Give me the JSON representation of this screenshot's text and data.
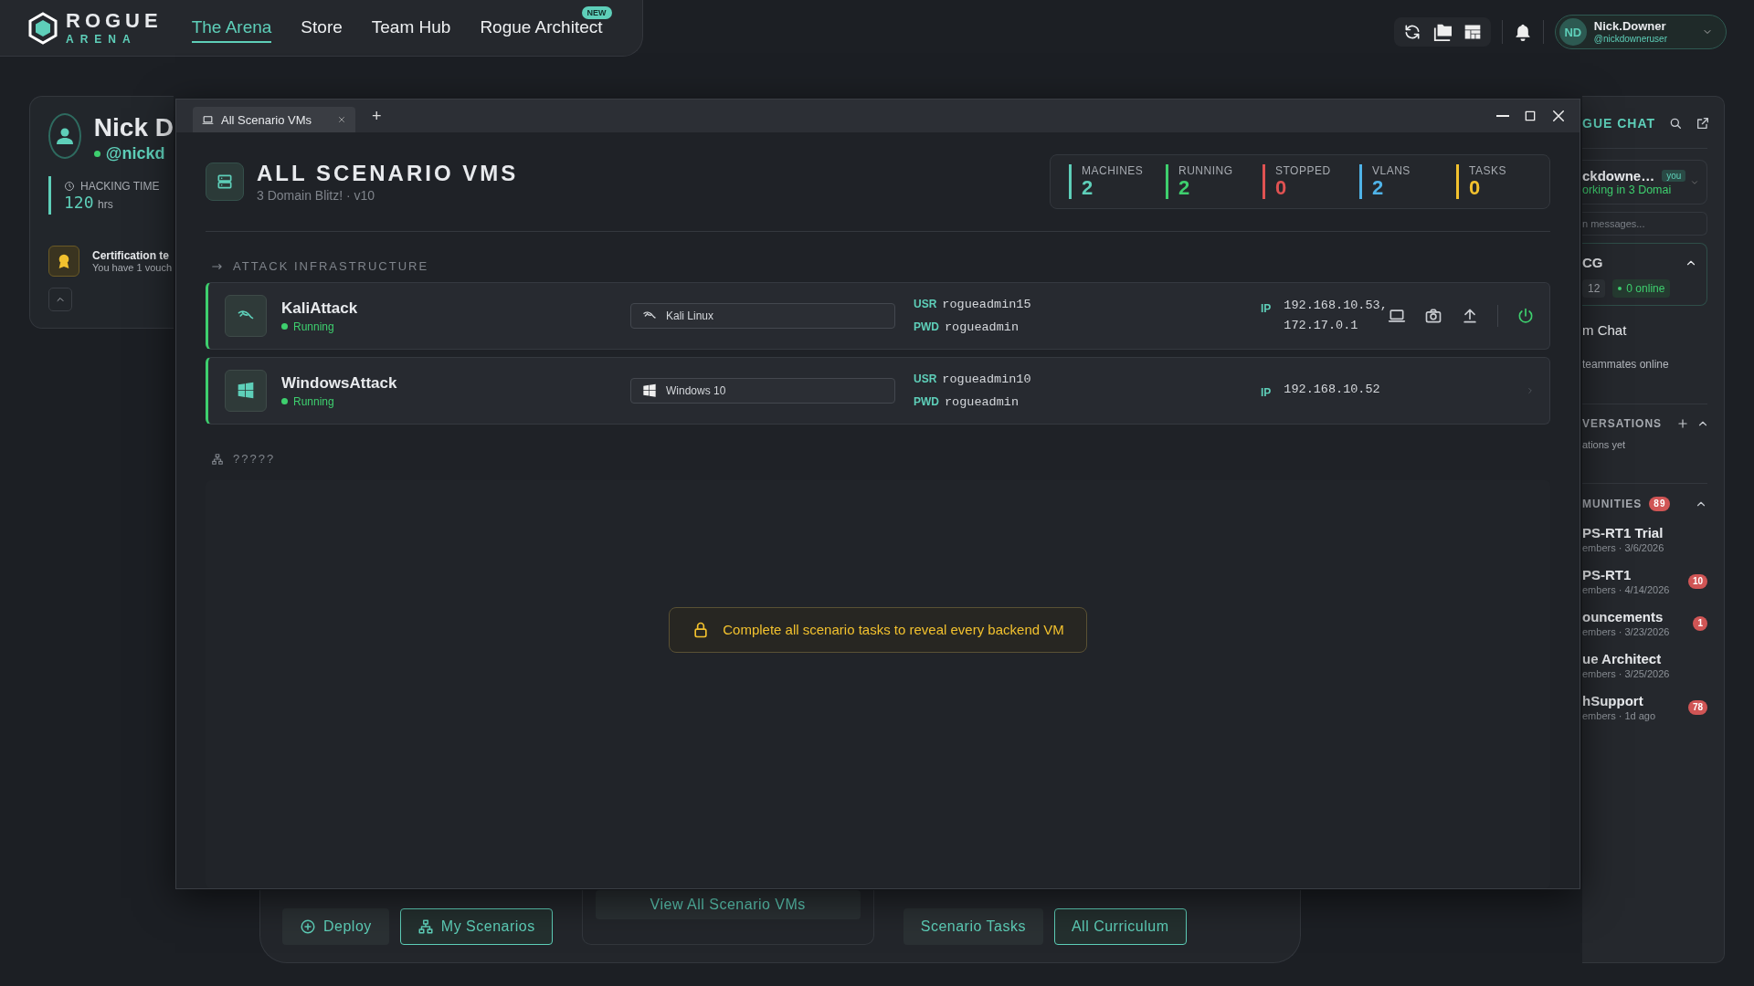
{
  "nav": {
    "logo_top": "ROGUE",
    "logo_bottom": "ARENA",
    "links": [
      {
        "label": "The Arena",
        "selected": true
      },
      {
        "label": "Store",
        "selected": false
      },
      {
        "label": "Team Hub",
        "selected": false
      },
      {
        "label": "Rogue Architect",
        "selected": false,
        "badge": "NEW"
      }
    ],
    "user": {
      "initials": "ND",
      "name": "Nick.Downer",
      "handle": "@nickdowneruser"
    }
  },
  "profile": {
    "name": "Nick D",
    "handle": "@nickd",
    "online": true,
    "stat_label": "HACKING TIME",
    "stat_value": "120",
    "stat_unit": "hrs",
    "cert_title": "Certification te",
    "cert_text": "You have 1 vouch"
  },
  "window": {
    "tab": "All Scenario VMs",
    "add_tab": "+",
    "title": "ALL SCENARIO VMS",
    "subtitle": "3 Domain Blitz! · v10",
    "stats": [
      {
        "label": "MACHINES",
        "value": "2",
        "color": "#5ecfb9"
      },
      {
        "label": "RUNNING",
        "value": "2",
        "color": "#3ecf6e"
      },
      {
        "label": "STOPPED",
        "value": "0",
        "color": "#e05252"
      },
      {
        "label": "VLANS",
        "value": "2",
        "color": "#4fb3e8"
      },
      {
        "label": "TASKS",
        "value": "0",
        "color": "#f2c12e"
      }
    ],
    "sections": [
      {
        "kind": "infra",
        "title": "ATTACK INFRASTRUCTURE",
        "vms": [
          {
            "name": "KaliAttack",
            "status": "Running",
            "running": true,
            "kind": "kali",
            "os": "Kali Linux",
            "usr_label": "USR",
            "usr": "rogueadmin15",
            "pwd_label": "PWD",
            "pwd": "rogueadmin",
            "ip_label": "IP",
            "ips": [
              "192.168.10.53,",
              "172.17.0.1"
            ],
            "actions_visible": true
          },
          {
            "name": "WindowsAttack",
            "status": "Running",
            "running": true,
            "kind": "windows",
            "os": "Windows 10",
            "usr_label": "USR",
            "usr": "rogueadmin10",
            "pwd_label": "PWD",
            "pwd": "rogueadmin",
            "ip_label": "IP",
            "ips": [
              "192.168.10.52"
            ],
            "actions_visible": false
          }
        ]
      },
      {
        "kind": "locked",
        "title": "?????",
        "notice": "Complete all scenario tasks to reveal every backend VM"
      }
    ]
  },
  "bottom": {
    "deploy": "Deploy",
    "my_scenarios": "My Scenarios",
    "view_all": "View All Scenario VMs",
    "tasks": "Scenario Tasks",
    "curriculum": "All Curriculum"
  },
  "chat": {
    "title": "GUE CHAT",
    "user": "ckdowne…",
    "you": "you",
    "status": "orking in 3 Domai",
    "search_placeholder": "n messages...",
    "team": "CG",
    "team_count": "12",
    "team_online": "0 online",
    "team_chat": "m Chat",
    "team_chat_sub": "teammates online",
    "conversations": "VERSATIONS",
    "conversations_empty": "ations yet",
    "communities": "MUNITIES",
    "communities_badge": "89",
    "items": [
      {
        "name": "PS-RT1 Trial",
        "meta": "embers · 3/6/2026"
      },
      {
        "name": "PS-RT1",
        "meta": "embers · 4/14/2026",
        "badge": "10"
      },
      {
        "name": "ouncements",
        "meta": "embers · 3/23/2026",
        "badge": "1"
      },
      {
        "name": "ue Architect",
        "meta": "embers · 3/25/2026"
      },
      {
        "name": "hSupport",
        "meta": "embers · 1d ago",
        "badge": "78"
      }
    ]
  }
}
